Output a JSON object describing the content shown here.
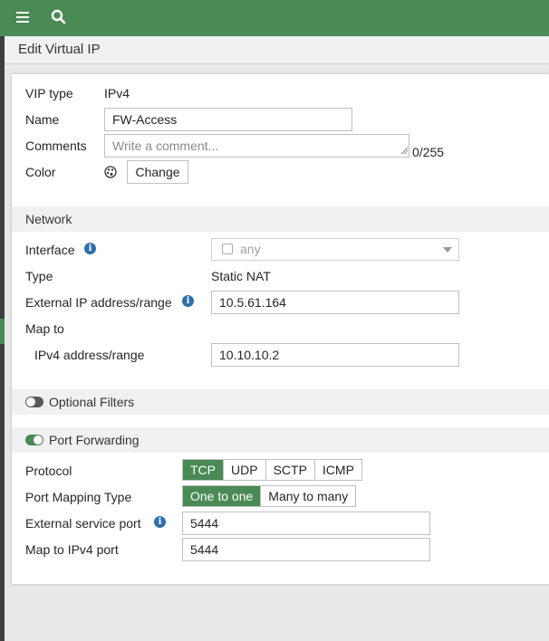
{
  "header": {
    "menu_icon": "hamburger-icon",
    "search_icon": "search-icon"
  },
  "page": {
    "title": "Edit Virtual IP"
  },
  "form": {
    "vip_type_label": "VIP type",
    "vip_type_value": "IPv4",
    "name_label": "Name",
    "name_value": "FW-Access",
    "comments_label": "Comments",
    "comments_placeholder": "Write a comment...",
    "comments_count": "0/255",
    "color_label": "Color",
    "color_button": "Change"
  },
  "network": {
    "title": "Network",
    "interface_label": "Interface",
    "interface_value": "any",
    "type_label": "Type",
    "type_value": "Static NAT",
    "external_ip_label": "External IP address/range",
    "external_ip_value": "10.5.61.164",
    "map_to_label": "Map to",
    "ipv4_label": "IPv4 address/range",
    "ipv4_value": "10.10.10.2"
  },
  "optional_filters": {
    "label": "Optional Filters",
    "enabled": false
  },
  "port_forwarding": {
    "label": "Port Forwarding",
    "enabled": true,
    "protocol_label": "Protocol",
    "protocols": [
      "TCP",
      "UDP",
      "SCTP",
      "ICMP"
    ],
    "protocol_selected": "TCP",
    "mapping_label": "Port Mapping Type",
    "mappings": [
      "One to one",
      "Many to many"
    ],
    "mapping_selected": "One to one",
    "ext_port_label": "External service port",
    "ext_port_value": "5444",
    "map_port_label": "Map to IPv4 port",
    "map_port_value": "5444"
  },
  "colors": {
    "accent": "#4a8a55",
    "info": "#2f6fad"
  }
}
